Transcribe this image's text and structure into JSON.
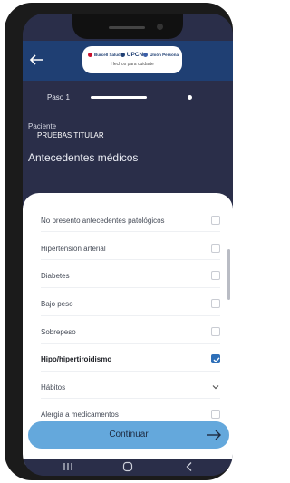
{
  "header": {
    "back_icon": "back-arrow-icon",
    "brands": [
      {
        "name": "Burcell Salud",
        "color": "#2a4f93"
      },
      {
        "name": "UPCN",
        "color": "#1f3f73"
      },
      {
        "name": "Unión Personal",
        "color": "#3b5fa8"
      }
    ],
    "tagline": "Hechos para cuidarte"
  },
  "progress": {
    "step_label": "Paso 1"
  },
  "patient": {
    "label": "Paciente",
    "name": "PRUEBAS TITULAR"
  },
  "section": {
    "title": "Antecedentes médicos"
  },
  "options": [
    {
      "label": "No presento antecedentes patológicos",
      "checked": false,
      "type": "checkbox"
    },
    {
      "label": "Hipertensión arterial",
      "checked": false,
      "type": "checkbox"
    },
    {
      "label": "Diabetes",
      "checked": false,
      "type": "checkbox"
    },
    {
      "label": "Bajo peso",
      "checked": false,
      "type": "checkbox"
    },
    {
      "label": "Sobrepeso",
      "checked": false,
      "type": "checkbox"
    },
    {
      "label": "Hipo/hipertiroidismo",
      "checked": true,
      "type": "checkbox"
    },
    {
      "label": "Hábitos",
      "checked": false,
      "type": "expand"
    },
    {
      "label": "Alergia a medicamentos",
      "checked": false,
      "type": "checkbox"
    }
  ],
  "footer": {
    "continue_label": "Continuar",
    "continue_icon": "arrow-right-icon"
  },
  "navbar": {
    "icons": [
      "recent-apps-icon",
      "home-icon",
      "back-nav-icon"
    ]
  },
  "colors": {
    "header_bg": "#1f3f73",
    "page_bg": "#2a2e49",
    "accent": "#2e6fb8",
    "button": "#64a8dc"
  }
}
